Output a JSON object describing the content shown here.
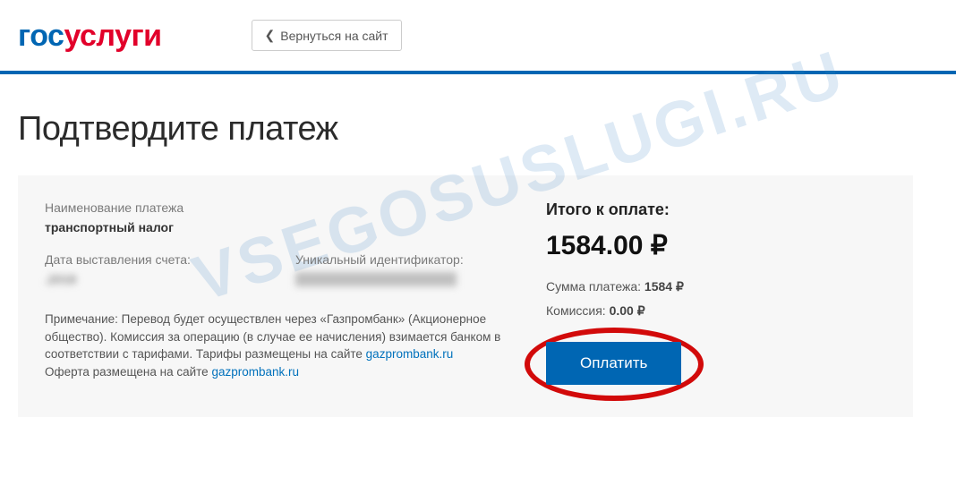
{
  "header": {
    "logo_part1": "гос",
    "logo_part2": "услуги",
    "back_label": "Вернуться на сайт"
  },
  "title": "Подтвердите платеж",
  "left": {
    "name_label": "Наименование платежа",
    "name_value": "транспортный налог",
    "date_label": "Дата выставления счета:",
    "date_value_masked": "    .2018",
    "uid_label": "Уникальный идентификатор:",
    "uid_value_masked": "                              ",
    "note_prefix": "Примечание: Перевод будет осуществлен через «Газпромбанк» (Акционерное общество). Комиссия за операцию (в случае ее начисления) взимается банком в соответствии с тарифами. Тарифы размещены на сайте ",
    "note_link1": "gazprombank.ru",
    "note_middle": "Оферта размещена на сайте ",
    "note_link2": "gazprombank.ru"
  },
  "right": {
    "total_label": "Итого к оплате:",
    "total_amount": "1584.00 ₽",
    "sum_label": "Сумма платежа: ",
    "sum_value": "1584 ₽",
    "commission_label": "Комиссия: ",
    "commission_value": "0.00 ₽",
    "pay_label": "Оплатить"
  },
  "watermark": "VSEGOSUSLUGI.RU"
}
